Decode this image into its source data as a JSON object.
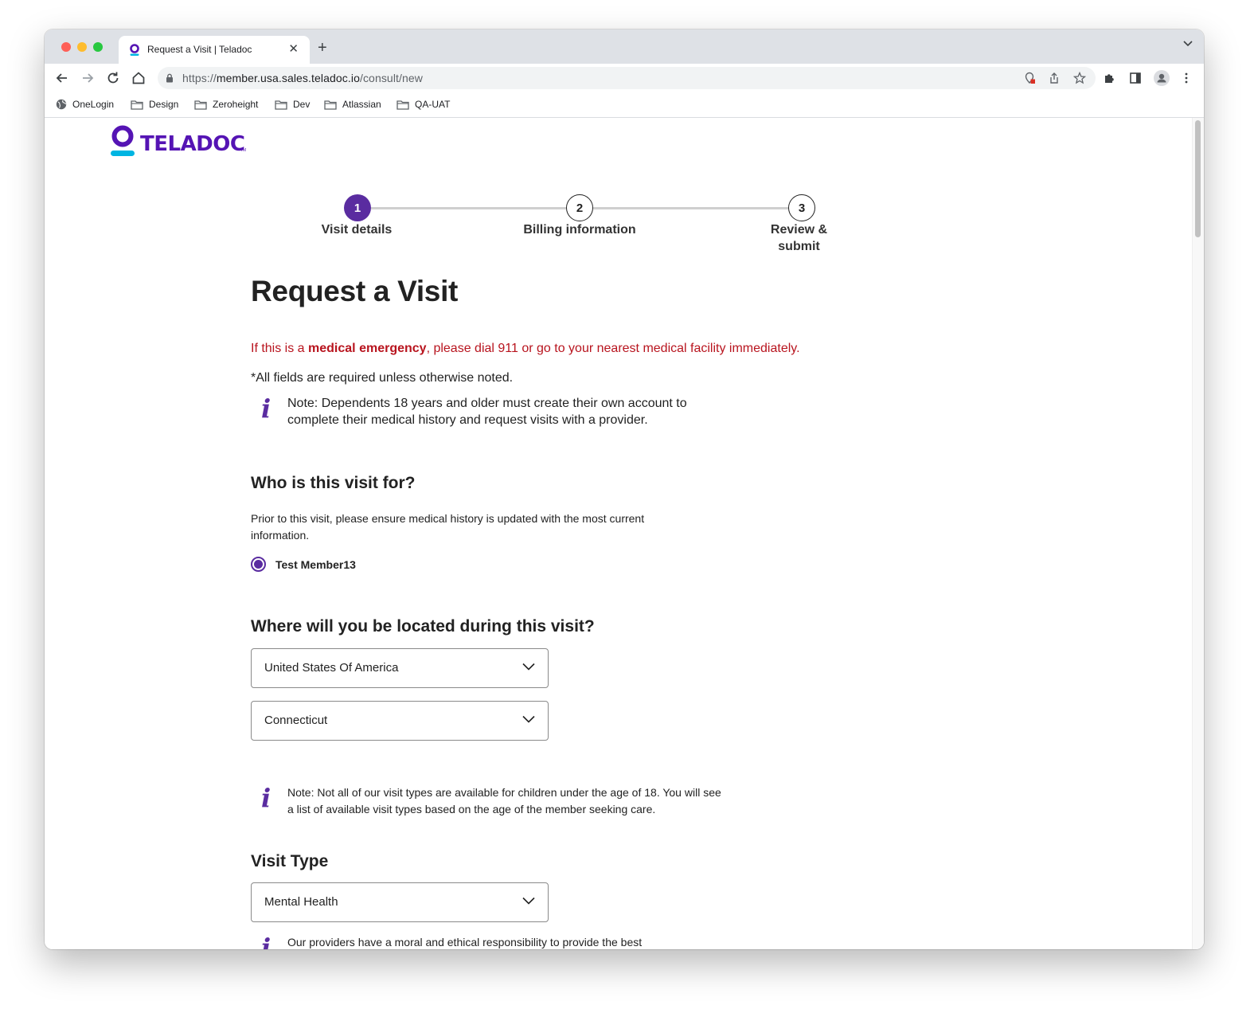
{
  "browser": {
    "tab_title": "Request a Visit | Teladoc",
    "url_prefix": "https://",
    "url_host": "member.usa.sales.teladoc.io",
    "url_path": "/consult/new",
    "bookmarks": [
      "OneLogin",
      "Design",
      "Zeroheight",
      "Dev",
      "Atlassian",
      "QA-UAT"
    ]
  },
  "logo": {
    "text": "TELADOC",
    "tm": "TM",
    "brand_color": "#5514b4"
  },
  "stepper": {
    "steps": [
      {
        "number": "1",
        "label": "Visit details",
        "state": "active"
      },
      {
        "number": "2",
        "label": "Billing information",
        "state": "idle"
      },
      {
        "number": "3",
        "label": "Review & submit",
        "state": "idle"
      }
    ]
  },
  "page": {
    "title": "Request a Visit",
    "emergency_prefix": "If this is a ",
    "emergency_bold": "medical emergency",
    "emergency_suffix": ", please dial 911 or go to your nearest medical facility immediately.",
    "required_note": "*All fields are required unless otherwise noted.",
    "dependents_note": "Note: Dependents 18 years and older must create their own account to complete their medical history and request visits with a provider.",
    "who_heading": "Who is this visit for?",
    "who_text": "Prior to this visit, please ensure medical history is updated with the most current information.",
    "member_name": "Test Member13",
    "location_heading": "Where will you be located during this visit?",
    "country_value": "United States Of America",
    "state_value": "Connecticut",
    "age_note": "Note: Not all of our visit types are available for children under the age of 18. You will see a list of available visit types based on the age of the member seeking care.",
    "visit_type_heading": "Visit Type",
    "visit_type_value": "Mental Health",
    "providers_note": "Our providers have a moral and ethical responsibility to provide the best"
  },
  "colors": {
    "accent": "#5a2ca0",
    "emergency": "#b8141e"
  }
}
